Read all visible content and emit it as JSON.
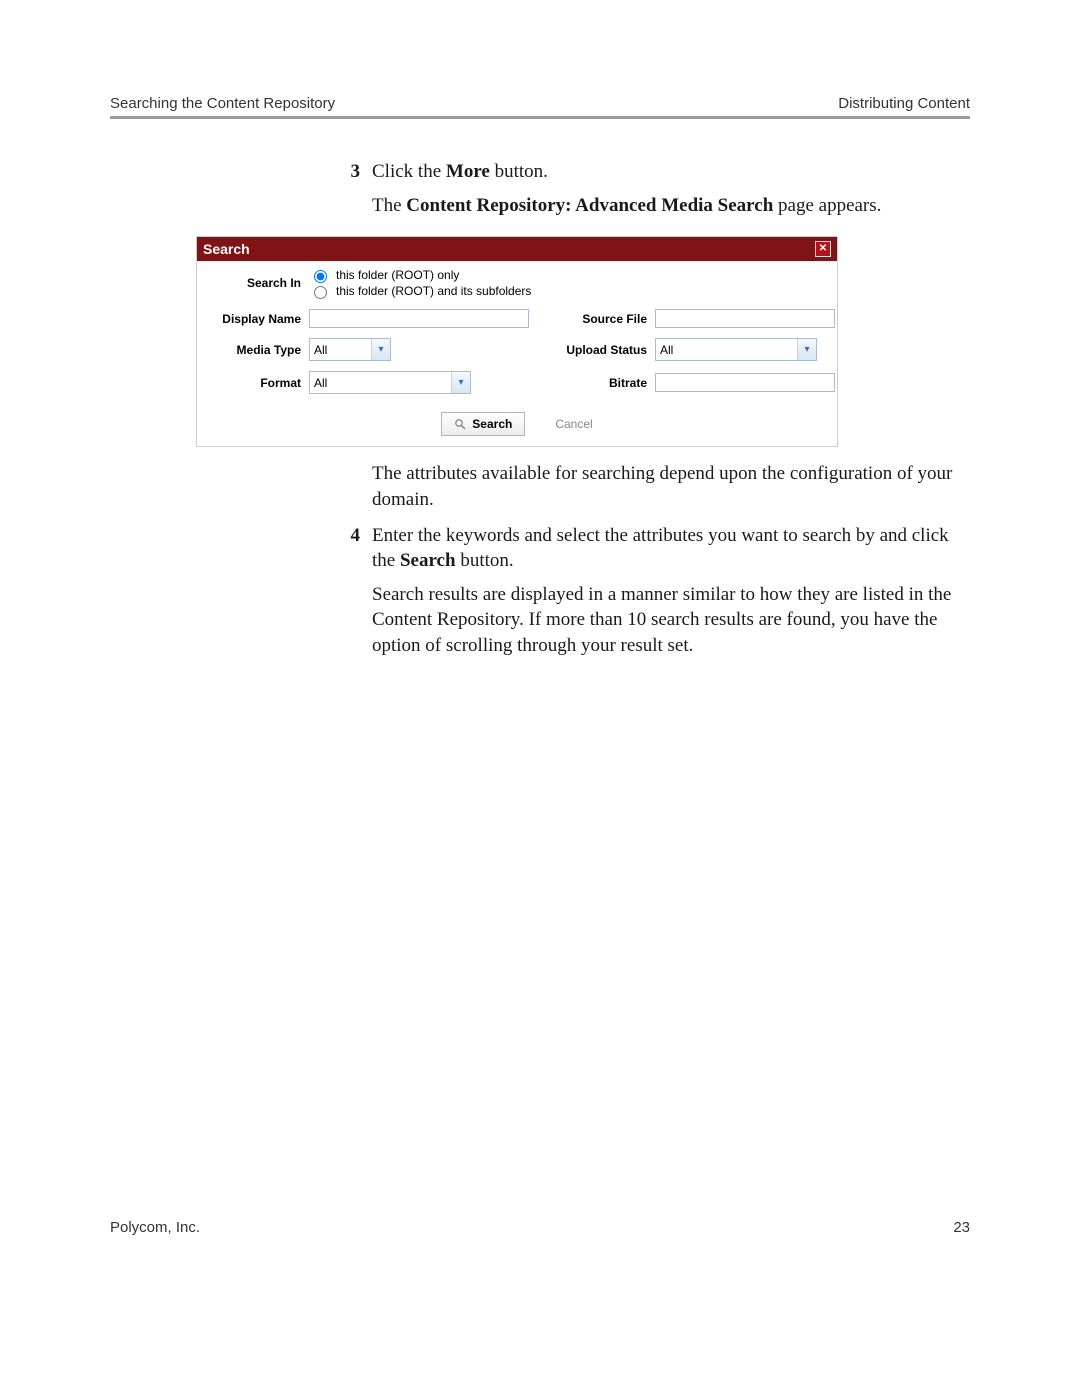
{
  "header": {
    "left": "Searching the Content Repository",
    "right": "Distributing Content"
  },
  "steps": {
    "s3_num": "3",
    "s3_text_a": "Click the ",
    "s3_text_b": "More",
    "s3_text_c": " button.",
    "s3_sub_a": "The ",
    "s3_sub_b": "Content Repository: Advanced Media Search",
    "s3_sub_c": " page appears.",
    "attr_note": "The attributes available for searching depend upon the configuration of your domain.",
    "s4_num": "4",
    "s4_text_a": "Enter the keywords and select the attributes you want to search by and click the ",
    "s4_text_b": "Search",
    "s4_text_c": " button.",
    "s4_result": "Search results are displayed in a manner similar to how they are listed in the Content Repository. If more than 10 search results are found, you have the option of scrolling through your result set."
  },
  "panel": {
    "title": "Search",
    "labels": {
      "search_in": "Search In",
      "display_name": "Display Name",
      "source_file": "Source File",
      "media_type": "Media Type",
      "upload_status": "Upload Status",
      "format": "Format",
      "bitrate": "Bitrate"
    },
    "radios": {
      "r1": "this folder (ROOT) only",
      "r2": "this folder (ROOT) and its subfolders"
    },
    "values": {
      "media_type": "All",
      "upload_status": "All",
      "format": "All"
    },
    "buttons": {
      "search": "Search",
      "cancel": "Cancel"
    }
  },
  "footer": {
    "left": "Polycom, Inc.",
    "right": "23"
  }
}
